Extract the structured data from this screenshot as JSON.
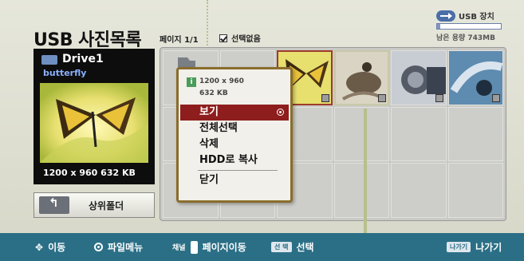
{
  "header": {
    "title": "USB 사진목록",
    "page_indicator": "페이지 1/1",
    "select_none": "선택없음"
  },
  "device": {
    "label": "USB 장치",
    "free_space": "남은 용량 743MB",
    "used_fraction": 0.05
  },
  "preview": {
    "drive": "Drive1",
    "folder": "butterfly",
    "info": "1200 x 960  632 KB"
  },
  "up_folder": {
    "label": "상위폴더"
  },
  "context_menu": {
    "resolution": "1200 x 960",
    "size": "632 KB",
    "items": [
      "보기",
      "전체선택",
      "삭제",
      "HDD로 복사",
      "닫기"
    ]
  },
  "bottom_bar": {
    "move": "이동",
    "file_menu": "파일메뉴",
    "channel": "채널",
    "page_move": "페이지이동",
    "select_key": "선 택",
    "select": "선택",
    "back_key": "나가기",
    "back": "나가기"
  },
  "colors": {
    "bottom_bar": "#2b6f86",
    "menu_active": "#8e1d1d",
    "menu_border": "#8a6d2c",
    "guide": "#b7c08c"
  }
}
